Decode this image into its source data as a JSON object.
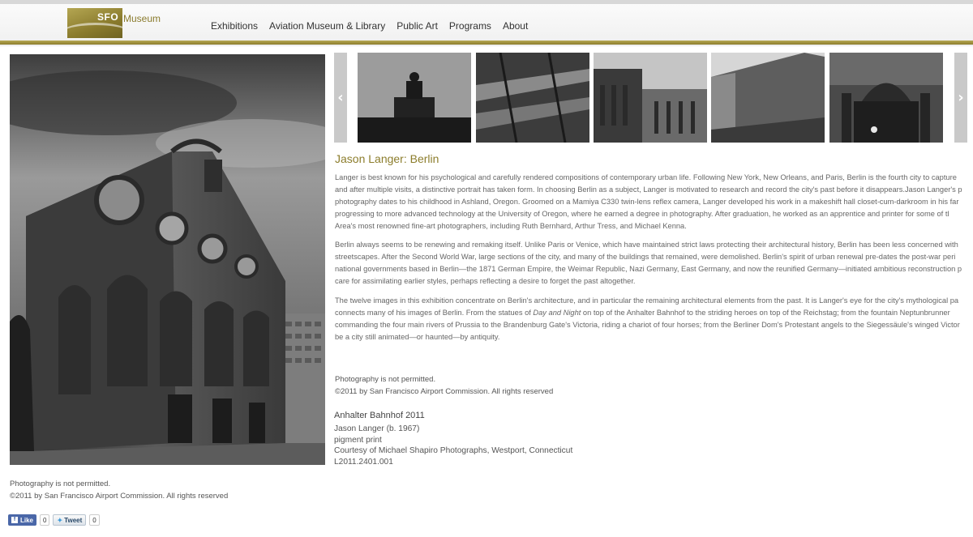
{
  "header": {
    "logo_sfo": "SFO",
    "logo_museum": "Museum",
    "nav": [
      "Exhibitions",
      "Aviation Museum & Library",
      "Public Art",
      "Programs",
      "About"
    ]
  },
  "carousel": {
    "prev_glyph": "‹",
    "next_glyph": "›",
    "thumbnails": [
      "brandenburg-gate-quadriga",
      "reichstag-dome-ramp",
      "reichstag-facade",
      "berlin-wall-segment",
      "berliner-dom-night"
    ]
  },
  "article": {
    "title": "Jason Langer: Berlin",
    "paragraph1": [
      "Langer is best known for his psychological and carefully rendered compositions of contemporary urban life. Following New York, New Orleans, and Paris, Berlin is the fourth city to capture",
      "and after multiple visits, a distinctive portrait has taken form. In choosing Berlin as a subject, Langer is motivated to research and record the city's past before it disappears.Jason Langer's p",
      "photography dates to his childhood in Ashland, Oregon. Groomed on a Mamiya C330 twin-lens reflex camera, Langer developed his work in a makeshift hall closet-cum-darkroom in his far",
      "progressing to more advanced technology at the University of Oregon, where he earned a degree in photography. After graduation, he worked as an apprentice and printer for some of tl",
      "Area's most renowned fine-art photographers, including Ruth Bernhard, Arthur Tress, and Michael Kenna."
    ],
    "paragraph2": [
      "Berlin always seems to be renewing and remaking itself. Unlike Paris or Venice, which have maintained strict laws protecting their architectural history, Berlin has been less concerned with ",
      "streetscapes. After the Second World War, large sections of the city, and many of the buildings that remained, were demolished. Berlin's spirit of urban renewal pre-dates the post-war peri",
      "national governments based in Berlin—the 1871 German Empire, the Weimar Republic, Nazi Germany, East Germany, and now the reunified Germany—initiated ambitious reconstruction p",
      "care for assimilating earlier styles, perhaps reflecting a desire to forget the past altogether."
    ],
    "paragraph3_line1": "The twelve images in this exhibition concentrate on Berlin's architecture, and in particular the remaining architectural elements from the past. It is Langer's eye for the city's mythological pa",
    "paragraph3_line2_a": "connects many of his images of Berlin. From the statues of ",
    "paragraph3_line2_em": "Day and Night",
    "paragraph3_line2_b": " on top of the Anhalter Bahnhof to the striding heroes on top of the Reichstag; from the fountain Neptunbrunner",
    "paragraph3_line3": "commanding the four main rivers of Prussia to the Brandenburg Gate's Victoria, riding a chariot of four horses; from the Berliner Dom's Protestant angels to the Siegessäule's winged Victor",
    "paragraph3_line4": "be a city still animated—or haunted—by antiquity.",
    "notice": "Photography is not permitted.",
    "copyright": "©2011 by San Francisco Airport Commission. All rights reserved"
  },
  "caption": {
    "title": "Anhalter Bahnhof 2011",
    "artist": "Jason Langer (b. 1967)",
    "medium": "pigment print",
    "credit": "Courtesy of Michael Shapiro Photographs, Westport, Connecticut",
    "accession": "L2011.2401.001"
  },
  "footer": {
    "notice": "Photography is not permitted.",
    "copyright": "©2011 by San Francisco Airport Commission. All rights reserved"
  },
  "social": {
    "like_label": "Like",
    "like_count": "0",
    "tweet_label": "Tweet",
    "tweet_count": "0"
  },
  "colors": {
    "accent_gold": "#8c7d2c",
    "facebook_blue": "#4a67a8"
  }
}
